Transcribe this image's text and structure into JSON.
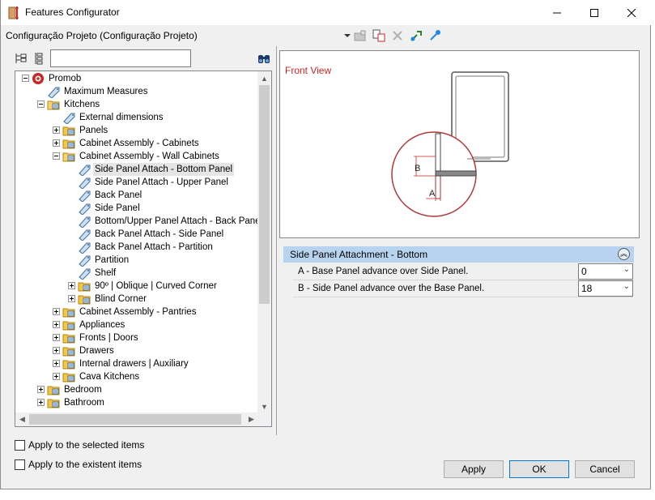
{
  "window": {
    "title": "Features Configurator",
    "minimize_icon": "minimize-icon",
    "maximize_icon": "maximize-icon",
    "close_icon": "close-icon"
  },
  "config_bar": {
    "label": "Configuração Projeto (Configuração Projeto)",
    "icons": [
      "dropdown-arrow-icon",
      "save-config-icon",
      "copy-config-icon",
      "delete-icon",
      "import-icon",
      "export-icon"
    ]
  },
  "tree_toolbar": {
    "icons": [
      "expand-tree-icon",
      "collapse-tree-icon",
      "binoculars-icon"
    ],
    "search_value": ""
  },
  "tree": {
    "items": [
      {
        "label": "Promob",
        "level": 0,
        "expander": "minus",
        "icon": "promob-logo-icon"
      },
      {
        "label": "Maximum Measures",
        "level": 1,
        "expander": "none",
        "icon": "feature-tag-icon"
      },
      {
        "label": "Kitchens",
        "level": 1,
        "expander": "minus",
        "icon": "folder-open-icon"
      },
      {
        "label": "External dimensions",
        "level": 2,
        "expander": "none",
        "icon": "feature-tag-icon"
      },
      {
        "label": "Panels",
        "level": 2,
        "expander": "plus",
        "icon": "folder-icon"
      },
      {
        "label": "Cabinet Assembly - Cabinets",
        "level": 2,
        "expander": "plus",
        "icon": "folder-icon"
      },
      {
        "label": "Cabinet Assembly - Wall Cabinets",
        "level": 2,
        "expander": "minus",
        "icon": "folder-open-icon"
      },
      {
        "label": "Side Panel Attach - Bottom Panel",
        "level": 3,
        "expander": "none",
        "icon": "feature-tag-icon",
        "selected": true
      },
      {
        "label": " Side Panel Attach - Upper Panel",
        "level": 3,
        "expander": "none",
        "icon": "feature-tag-icon"
      },
      {
        "label": "Back Panel",
        "level": 3,
        "expander": "none",
        "icon": "feature-tag-icon"
      },
      {
        "label": "Side Panel",
        "level": 3,
        "expander": "none",
        "icon": "feature-tag-icon"
      },
      {
        "label": " Bottom/Upper Panel Attach - Back Panel",
        "level": 3,
        "expander": "none",
        "icon": "feature-tag-icon"
      },
      {
        "label": "Back Panel Attach - Side Panel",
        "level": 3,
        "expander": "none",
        "icon": "feature-tag-icon"
      },
      {
        "label": "Back Panel Attach - Partition",
        "level": 3,
        "expander": "none",
        "icon": "feature-tag-icon"
      },
      {
        "label": "Partition",
        "level": 3,
        "expander": "none",
        "icon": "feature-tag-icon"
      },
      {
        "label": "Shelf",
        "level": 3,
        "expander": "none",
        "icon": "feature-tag-icon"
      },
      {
        "label": "90º | Oblique | Curved Corner",
        "level": 3,
        "expander": "plus",
        "icon": "folder-icon"
      },
      {
        "label": "Blind Corner",
        "level": 3,
        "expander": "plus",
        "icon": "folder-icon"
      },
      {
        "label": "Cabinet Assembly - Pantries",
        "level": 2,
        "expander": "plus",
        "icon": "folder-icon"
      },
      {
        "label": "Appliances",
        "level": 2,
        "expander": "plus",
        "icon": "folder-icon"
      },
      {
        "label": "Fronts | Doors",
        "level": 2,
        "expander": "plus",
        "icon": "folder-icon"
      },
      {
        "label": "Drawers",
        "level": 2,
        "expander": "plus",
        "icon": "folder-icon"
      },
      {
        "label": "Internal drawers | Auxiliary",
        "level": 2,
        "expander": "plus",
        "icon": "folder-icon"
      },
      {
        "label": "Cava Kitchens",
        "level": 2,
        "expander": "plus",
        "icon": "folder-icon"
      },
      {
        "label": "Bedroom",
        "level": 1,
        "expander": "plus",
        "icon": "folder-icon"
      },
      {
        "label": "Bathroom",
        "level": 1,
        "expander": "plus",
        "icon": "folder-icon"
      }
    ]
  },
  "preview": {
    "view_label": "Front View",
    "dim_a": "A",
    "dim_b": "B",
    "colors": {
      "view_label": "#c62828",
      "detail_circle": "#b03a3a",
      "dim_line": "#c62828"
    }
  },
  "properties": {
    "header": "Side Panel Attachment - Bottom",
    "collapse_icon": "collapse-chevrons-icon",
    "rows": [
      {
        "label": "A - Base Panel advance over Side Panel.",
        "value": "0"
      },
      {
        "label": "B - Side Panel advance over the Base Panel.",
        "value": "18"
      }
    ]
  },
  "options": {
    "apply_selected": "Apply to the selected items",
    "apply_existent": "Apply to the existent items"
  },
  "buttons": {
    "apply": "Apply",
    "ok": "OK",
    "cancel": "Cancel"
  },
  "colors": {
    "header_bg": "#b8d3ef",
    "selection_bg": "#e5e5e5",
    "default_button_border": "#0078d7"
  }
}
